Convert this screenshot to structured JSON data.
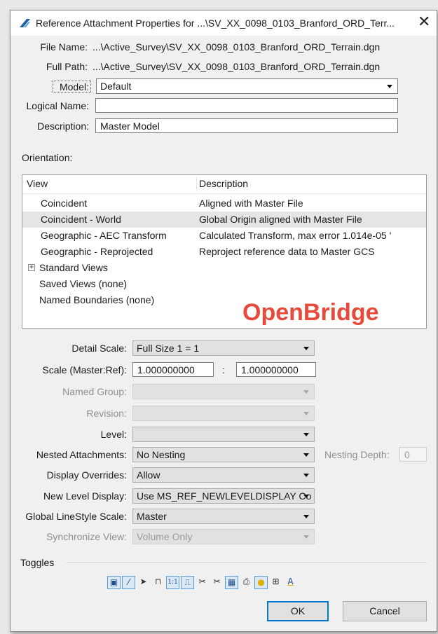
{
  "window": {
    "title": "Reference Attachment Properties for ...\\SV_XX_0098_0103_Branford_ORD_Terr...",
    "close_glyph": "✕",
    "app_icon": "openroads-app-icon"
  },
  "file": {
    "file_name_label": "File Name:",
    "file_name_value": "...\\Active_Survey\\SV_XX_0098_0103_Branford_ORD_Terrain.dgn",
    "full_path_label": "Full Path:",
    "full_path_value": "...\\Active_Survey\\SV_XX_0098_0103_Branford_ORD_Terrain.dgn",
    "model_label": "Model:",
    "model_value": "Default",
    "logical_name_label": "Logical Name:",
    "logical_name_value": "",
    "description_label": "Description:",
    "description_value": "Master Model"
  },
  "orientation": {
    "label": "Orientation:",
    "columns": [
      "View",
      "Description"
    ],
    "rows": [
      {
        "view": "Coincident",
        "description": "Aligned with Master File"
      },
      {
        "view": "Coincident - World",
        "description": "Global Origin aligned with Master File"
      },
      {
        "view": "Geographic - AEC Transform",
        "description": "Calculated Transform, max error 1.014e-05 '"
      },
      {
        "view": "Geographic - Reprojected",
        "description": "Reproject reference data to Master GCS"
      },
      {
        "view": "Standard Views",
        "description": ""
      },
      {
        "view": "Saved Views (none)",
        "description": ""
      },
      {
        "view": "Named Boundaries (none)",
        "description": ""
      }
    ],
    "expander_glyph": "+",
    "watermark": "OpenBridge"
  },
  "properties": {
    "detail_scale_label": "Detail Scale:",
    "detail_scale_value": "Full Size 1 = 1",
    "scale_label": "Scale (Master:Ref):",
    "scale_master": "1.000000000",
    "scale_sep": ":",
    "scale_ref": "1.000000000",
    "named_group_label": "Named Group:",
    "named_group_value": "",
    "revision_label": "Revision:",
    "revision_value": "",
    "level_label": "Level:",
    "level_value": "",
    "nested_label": "Nested Attachments:",
    "nested_value": "No Nesting",
    "nesting_depth_label": "Nesting Depth:",
    "nesting_depth_value": "0",
    "display_overrides_label": "Display Overrides:",
    "display_overrides_value": "Allow",
    "new_level_label": "New Level Display:",
    "new_level_value": "Use MS_REF_NEWLEVELDISPLAY Co",
    "global_ls_label": "Global LineStyle Scale:",
    "global_ls_value": "Master",
    "sync_view_label": "Synchronize View:",
    "sync_view_value": "Volume Only"
  },
  "toggles": {
    "label": "Toggles",
    "icons": [
      {
        "name": "display-toggle-icon",
        "glyph": "▣",
        "on": true
      },
      {
        "name": "snap-toggle-icon",
        "glyph": "⁄",
        "on": true
      },
      {
        "name": "locate-toggle-icon",
        "glyph": "➤",
        "on": false
      },
      {
        "name": "lock-toggle-icon",
        "glyph": "⊓",
        "on": false
      },
      {
        "name": "scale-lines-toggle-icon",
        "glyph": "1:1",
        "on": true
      },
      {
        "name": "line-style-toggle-icon",
        "glyph": "⎍",
        "on": true
      },
      {
        "name": "clip-back-toggle-icon",
        "glyph": "✂",
        "on": false
      },
      {
        "name": "clip-front-toggle-icon",
        "glyph": "✂",
        "on": false
      },
      {
        "name": "raster-toggle-icon",
        "glyph": "▦",
        "on": true
      },
      {
        "name": "print-toggle-icon",
        "glyph": "⎙",
        "on": false
      },
      {
        "name": "highlight-toggle-icon",
        "glyph": "●",
        "on": true
      },
      {
        "name": "treat-as-element-icon",
        "glyph": "⊞",
        "on": false
      },
      {
        "name": "text-toggle-icon",
        "glyph": "A",
        "on": false
      }
    ]
  },
  "buttons": {
    "ok": "OK",
    "cancel": "Cancel"
  },
  "colors": {
    "accent": "#0078d7",
    "watermark": "#e64a3a",
    "toggle_on_bg": "#dbe9f7"
  }
}
